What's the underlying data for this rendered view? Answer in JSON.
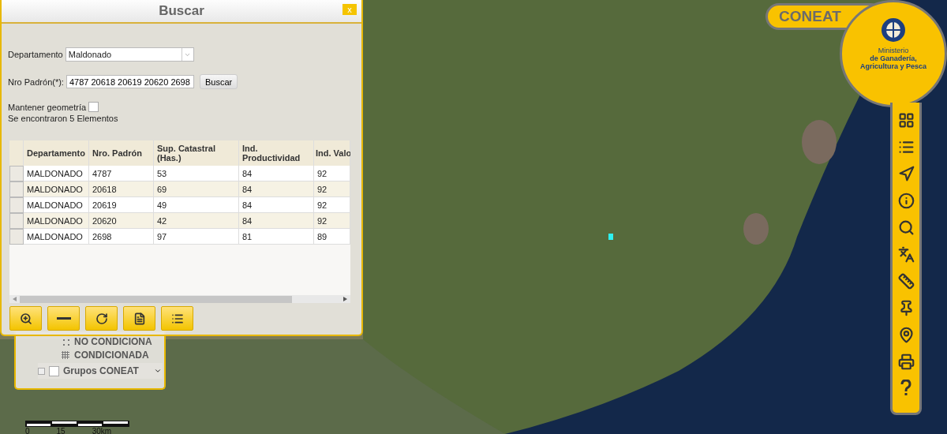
{
  "search_dialog": {
    "title": "Buscar",
    "close": "x",
    "department": {
      "label": "Departamento",
      "value": "Maldonado"
    },
    "padron": {
      "label": "Nro Padrón(*):",
      "value": "4787 20618 20619 20620 2698"
    },
    "search_button": "Buscar",
    "keep_geometry": {
      "label": "Mantener geometría",
      "checked": false
    },
    "result_text": "Se encontraron 5 Elementos",
    "table": {
      "columns": [
        "Departamento",
        "Nro. Padrón",
        "Sup. Catastral (Has.)",
        "Ind. Productividad",
        "Ind. Valo"
      ],
      "rows": [
        {
          "cells": [
            "MALDONADO",
            "4787",
            "53",
            "84",
            "92"
          ],
          "selected": false
        },
        {
          "cells": [
            "MALDONADO",
            "20618",
            "69",
            "84",
            "92"
          ],
          "selected": false
        },
        {
          "cells": [
            "MALDONADO",
            "20619",
            "49",
            "84",
            "92"
          ],
          "selected": false
        },
        {
          "cells": [
            "MALDONADO",
            "20620",
            "42",
            "84",
            "92"
          ],
          "selected": false
        },
        {
          "cells": [
            "MALDONADO",
            "2698",
            "97",
            "81",
            "89"
          ],
          "selected": false
        }
      ]
    },
    "tools": [
      {
        "kind": "zoom"
      },
      {
        "kind": "minus"
      },
      {
        "kind": "refresh"
      },
      {
        "kind": "document"
      },
      {
        "kind": "list"
      }
    ]
  },
  "layers_panel": {
    "items": [
      {
        "kind": "dots",
        "label": "NO CONDICIONA"
      },
      {
        "kind": "grid",
        "label": "CONDICIONADA"
      }
    ],
    "group": {
      "label": "Grupos CONEAT",
      "checked": false,
      "expanded": true
    }
  },
  "scale_bar": {
    "labels": [
      "0",
      "15",
      "30km"
    ]
  },
  "app_badge": "CONEAT",
  "ministry": {
    "line1": "Ministerio",
    "line2": "de Ganadería,",
    "line3": "Agricultura y Pesca"
  },
  "toolbar": [
    {
      "kind": "grid"
    },
    {
      "kind": "list"
    },
    {
      "kind": "navigate"
    },
    {
      "kind": "info"
    },
    {
      "kind": "search"
    },
    {
      "kind": "translate"
    },
    {
      "kind": "ruler"
    },
    {
      "kind": "pin"
    },
    {
      "kind": "location"
    },
    {
      "kind": "print"
    },
    {
      "kind": "help"
    }
  ]
}
